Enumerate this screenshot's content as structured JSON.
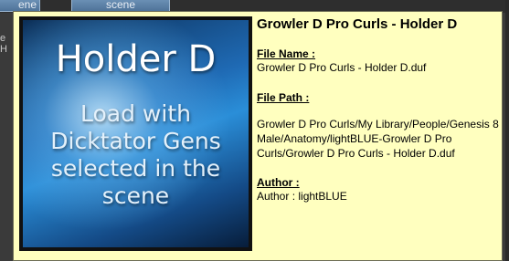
{
  "background": {
    "tab_left_text": "ene",
    "tab_text": "scene",
    "left_letters": "e\nH"
  },
  "tooltip": {
    "thumbnail": {
      "title": "Holder D",
      "description": "Load with Dicktator Gens selected in the scene",
      "colors": {
        "dark": "#0c2f57",
        "mid": "#1f6ab4",
        "highlight": "#c8ebff"
      }
    },
    "title": "Growler D Pro Curls - Holder D",
    "file_name_label": "File Name :",
    "file_name_value": "Growler D Pro Curls - Holder D.duf",
    "file_path_label": "File Path :",
    "file_path_value": "Growler D Pro Curls/My Library/People/Genesis 8 Male/Anatomy/lightBLUE-Growler D Pro Curls/Growler D Pro Curls - Holder D.duf",
    "author_label": "Author :",
    "author_value": "Author : lightBLUE",
    "background_color": "#ffffbf"
  }
}
